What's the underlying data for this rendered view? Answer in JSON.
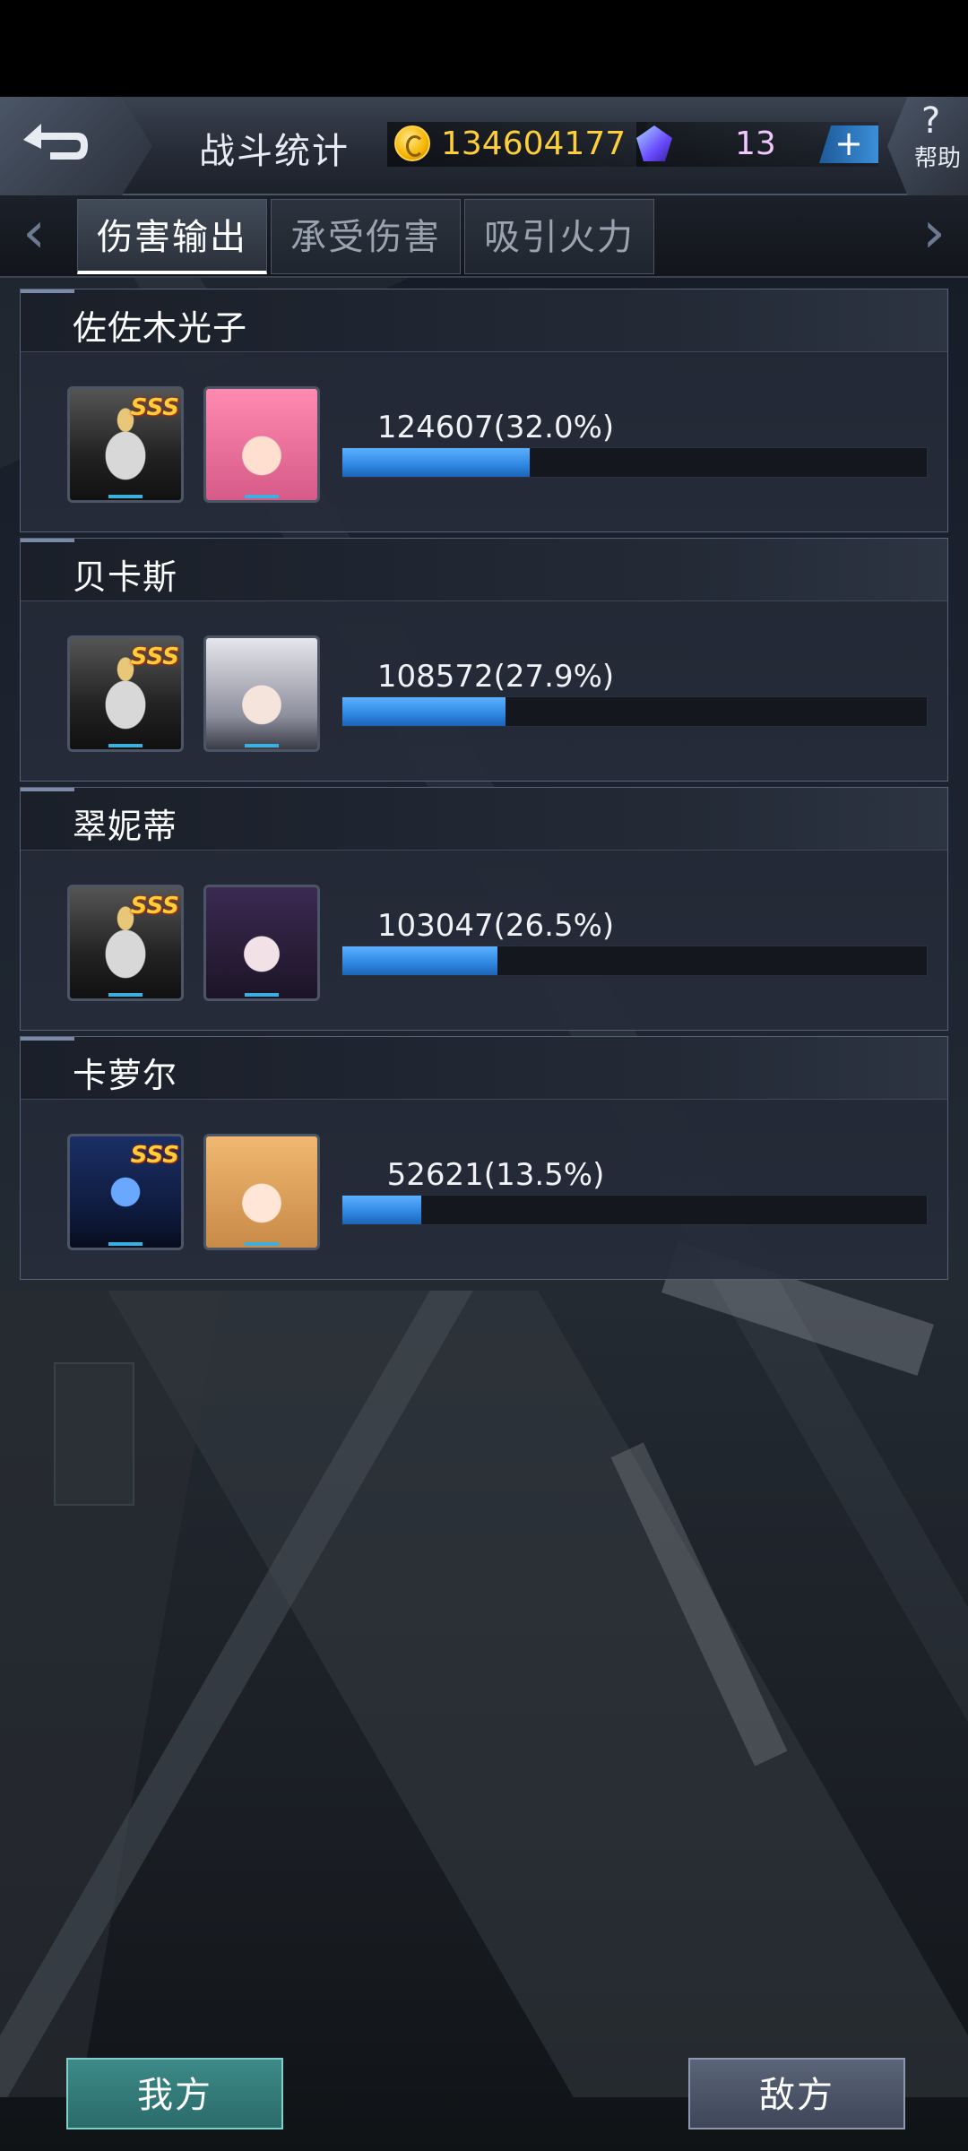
{
  "header": {
    "title": "战斗统计",
    "coins": "134604177",
    "gems": "13",
    "plus_label": "+",
    "help_symbol": "?",
    "help_label": "帮助"
  },
  "tabs": [
    {
      "label": "伤害输出",
      "active": true
    },
    {
      "label": "承受伤害",
      "active": false
    },
    {
      "label": "吸引火力",
      "active": false
    }
  ],
  "nav": {
    "prev": "‹",
    "next": "›"
  },
  "entries": [
    {
      "name": "佐佐木光子",
      "mech_rank": "SSS",
      "value_text": "124607(32.0%)",
      "percent": 32.0
    },
    {
      "name": "贝卡斯",
      "mech_rank": "SSS",
      "value_text": "108572(27.9%)",
      "percent": 27.9
    },
    {
      "name": "翠妮蒂",
      "mech_rank": "SSS",
      "value_text": "103047(26.5%)",
      "percent": 26.5
    },
    {
      "name": "卡萝尔",
      "mech_rank": "SSS",
      "value_text": "52621(13.5%)",
      "percent": 13.5
    }
  ],
  "bottom": {
    "mine_label": "我方",
    "enemy_label": "敌方"
  },
  "colors": {
    "bar_fill": "#2e86e0",
    "coin_text": "#ffcf3a",
    "gem_text": "#f0c8ff",
    "mine_button": "#2a6b6a",
    "enemy_button": "#3e4658"
  }
}
